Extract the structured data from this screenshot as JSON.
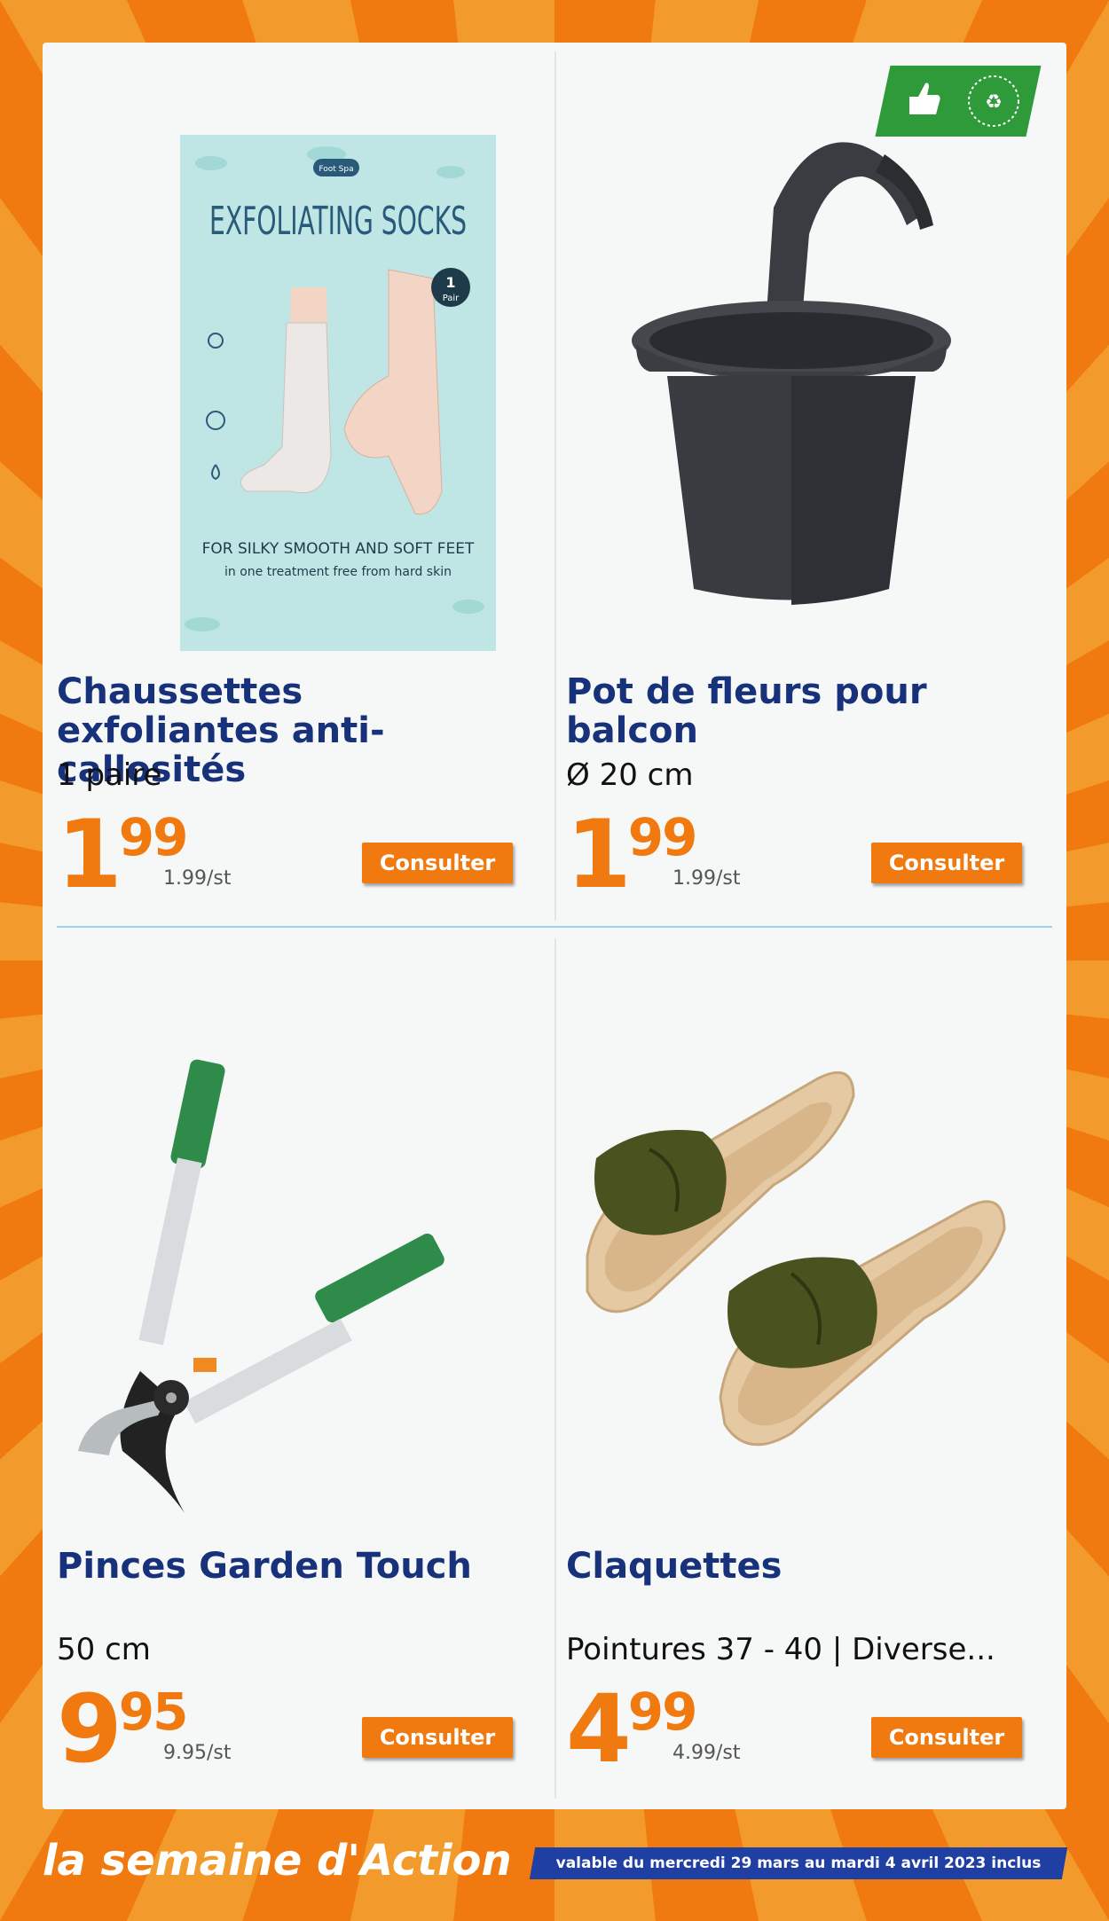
{
  "products": [
    {
      "title": "Chaussettes exfoliantes anti-callosités",
      "subtitle": "1 paire",
      "price_main": "1",
      "price_cents": "99",
      "unit_price": "1.99/st",
      "button": "Consulter",
      "package_brand": "Foot Spa",
      "package_title": "EXFOLIATING SOCKS",
      "package_badge_top": "1",
      "package_badge_bottom": "Pair",
      "package_line1": "FOR SILKY SMOOTH AND SOFT FEET",
      "package_line2": "in one treatment free from hard skin"
    },
    {
      "title": "Pot de fleurs pour balcon",
      "subtitle": "Ø 20 cm",
      "price_main": "1",
      "price_cents": "99",
      "unit_price": "1.99/st",
      "button": "Consulter",
      "badge_text": "MADE WITH RECYCLED MATERIALS"
    },
    {
      "title": "Pinces Garden Touch",
      "subtitle": "50 cm",
      "price_main": "9",
      "price_cents": "95",
      "unit_price": "9.95/st",
      "button": "Consulter"
    },
    {
      "title": "Claquettes",
      "subtitle": "Pointures 37 - 40 | Diverse...",
      "price_main": "4",
      "price_cents": "99",
      "unit_price": "4.99/st",
      "button": "Consulter"
    }
  ],
  "footer": {
    "title": "la semaine d'Action",
    "validity": "valable du mercredi 29 mars au mardi 4 avril 2023 inclus"
  },
  "colors": {
    "accent": "#f07a10",
    "title_blue": "#17327a",
    "banner_blue": "#1f3fa3",
    "badge_green": "#2f9a3a"
  }
}
